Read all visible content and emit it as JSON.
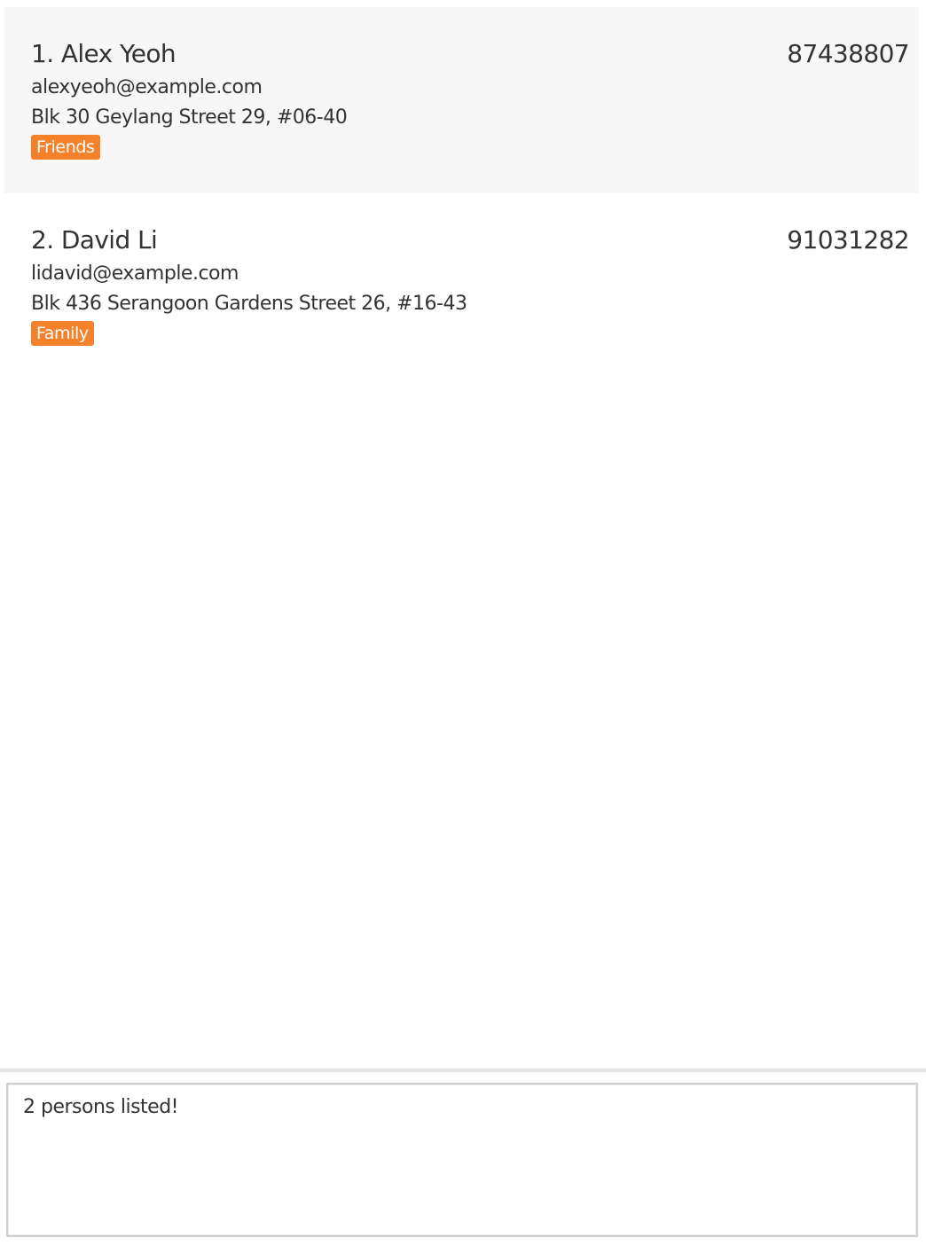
{
  "persons": [
    {
      "index_name": "1. Alex Yeoh",
      "phone": "87438807",
      "email": "alexyeoh@example.com",
      "address": "Blk 30 Geylang Street 29, #06-40",
      "tags": [
        "Friends"
      ]
    },
    {
      "index_name": "2. David Li",
      "phone": "91031282",
      "email": "lidavid@example.com",
      "address": "Blk 436 Serangoon Gardens Street 26, #16-43",
      "tags": [
        "Family"
      ]
    }
  ],
  "result_display": {
    "text": "2 persons listed!"
  },
  "colors": {
    "tag_background": "#f5822a",
    "tag_text": "#ffffff",
    "card_alt_background": "#f7f7f7",
    "text": "#333333"
  }
}
